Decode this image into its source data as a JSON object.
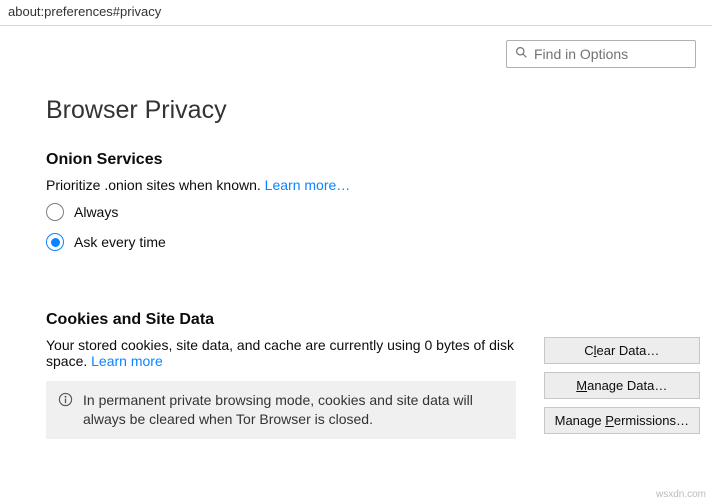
{
  "url": "about:preferences#privacy",
  "search": {
    "placeholder": "Find in Options"
  },
  "page_title": "Browser Privacy",
  "onion": {
    "title": "Onion Services",
    "desc": "Prioritize .onion sites when known. ",
    "learn_more": "Learn more…",
    "options": {
      "always": "Always",
      "ask": "Ask every time"
    }
  },
  "cookies": {
    "title": "Cookies and Site Data",
    "desc_prefix": "Your stored cookies, site data, and cache are currently using 0 bytes of disk space.  ",
    "learn_more": "Learn more",
    "buttons": {
      "clear": {
        "pre": "C",
        "ul": "l",
        "post": "ear Data…"
      },
      "manage": {
        "pre": "",
        "ul": "M",
        "post": "anage Data…"
      },
      "permissions": {
        "pre": "Manage ",
        "ul": "P",
        "post": "ermissions…"
      }
    },
    "info": "In permanent private browsing mode, cookies and site data will always be cleared when Tor Browser is closed."
  },
  "watermark": "wsxdn.com"
}
